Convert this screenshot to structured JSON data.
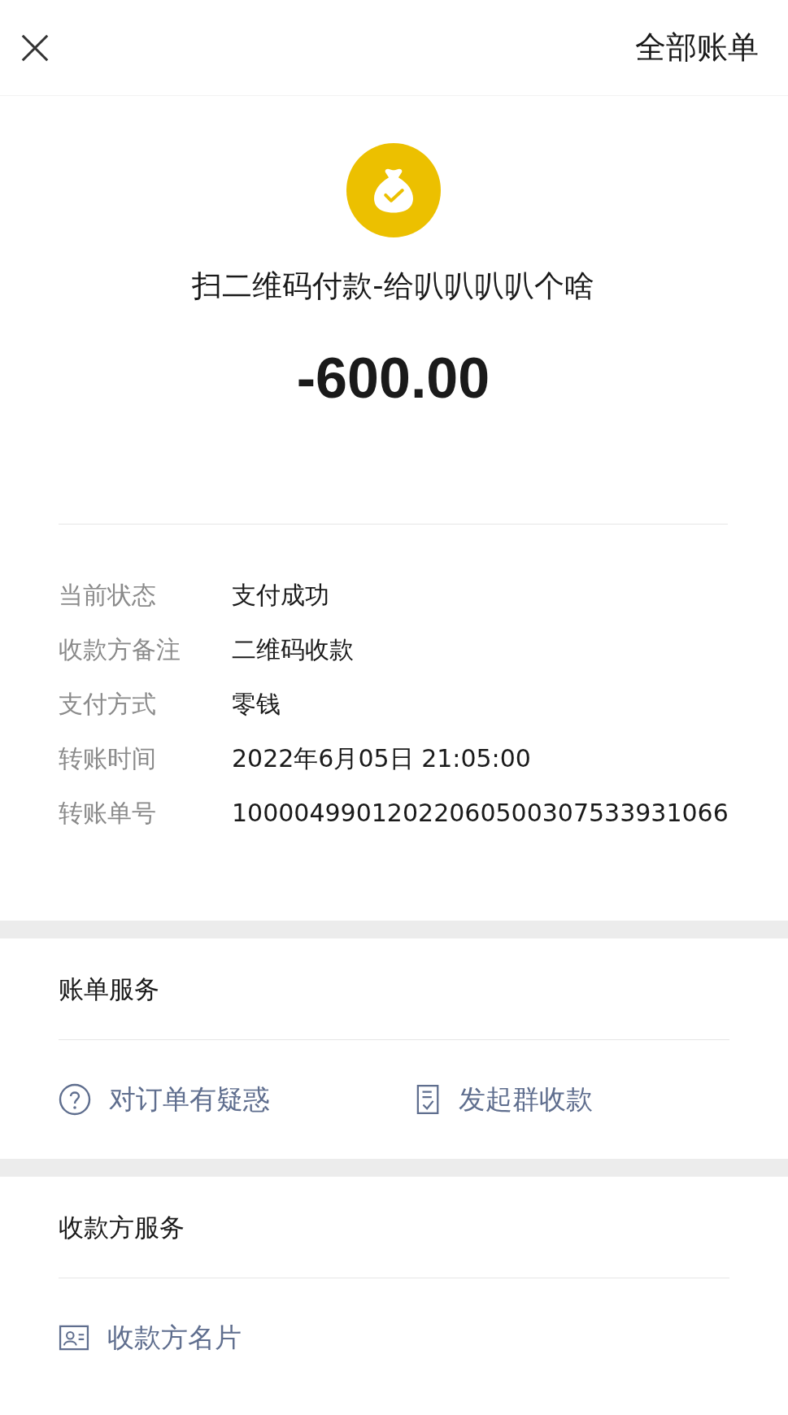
{
  "header": {
    "title": "全部账单"
  },
  "transaction": {
    "title": "扫二维码付款-给叭叭叭叭个啥",
    "amount": "-600.00"
  },
  "details": [
    {
      "label": "当前状态",
      "value": "支付成功"
    },
    {
      "label": "收款方备注",
      "value": "二维码收款"
    },
    {
      "label": "支付方式",
      "value": "零钱"
    },
    {
      "label": "转账时间",
      "value": "2022年6月05日 21:05:00"
    },
    {
      "label": "转账单号",
      "value": "10000499012022060500307533931066"
    }
  ],
  "sections": [
    {
      "title": "账单服务",
      "actions": [
        {
          "label": "对订单有疑惑"
        },
        {
          "label": "发起群收款"
        }
      ]
    },
    {
      "title": "收款方服务",
      "actions": [
        {
          "label": "收款方名片"
        }
      ]
    }
  ]
}
